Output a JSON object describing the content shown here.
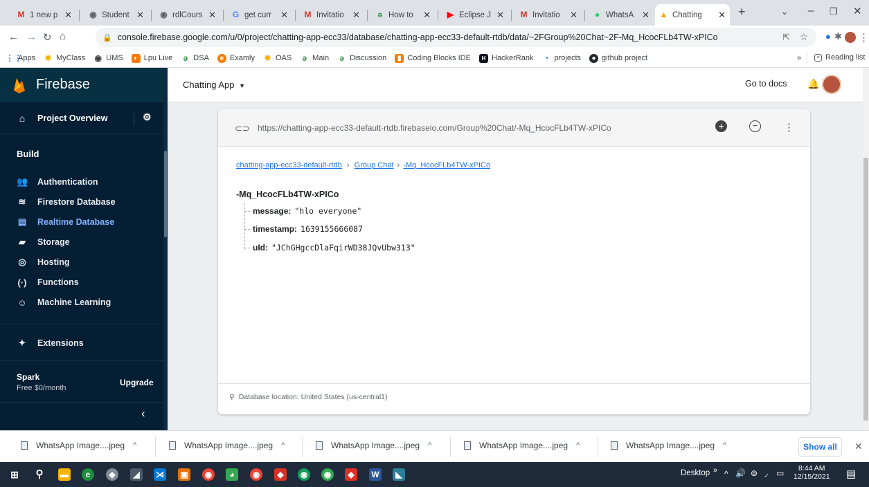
{
  "browser": {
    "tabs": [
      {
        "label": "1 new p",
        "icon": "gmail-icon"
      },
      {
        "label": "Student",
        "icon": "globe-icon"
      },
      {
        "label": "rdlCours",
        "icon": "globe-icon"
      },
      {
        "label": "get curr",
        "icon": "google-icon"
      },
      {
        "label": "Invitatio",
        "icon": "gmail-icon"
      },
      {
        "label": "How to",
        "icon": "gfg-icon"
      },
      {
        "label": "Eclipse J",
        "icon": "youtube-icon"
      },
      {
        "label": "Invitatio",
        "icon": "gmail-icon"
      },
      {
        "label": "WhatsA",
        "icon": "whatsapp-icon"
      },
      {
        "label": "Chatting",
        "icon": "firebase-icon",
        "active": true
      }
    ],
    "url": "console.firebase.google.com/u/0/project/chatting-app-ecc33/database/chatting-app-ecc33-default-rtdb/data/~2FGroup%20Chat~2F-Mq_HcocFLb4TW-xPICo",
    "bookmarks": [
      {
        "label": "Apps"
      },
      {
        "label": "MyClass"
      },
      {
        "label": "UMS"
      },
      {
        "label": "Lpu Live"
      },
      {
        "label": "DSA"
      },
      {
        "label": "Examly"
      },
      {
        "label": "OAS"
      },
      {
        "label": "Main"
      },
      {
        "label": "Discussion"
      },
      {
        "label": "Coding Blocks IDE"
      },
      {
        "label": "HackerRank"
      },
      {
        "label": "projects"
      },
      {
        "label": "github project"
      }
    ],
    "reading_list": "Reading list"
  },
  "firebase": {
    "logo_text": "Firebase",
    "project_name": "Chatting App",
    "go_to_docs": "Go to docs",
    "project_overview": "Project Overview",
    "build_label": "Build",
    "nav": [
      {
        "label": "Authentication",
        "icon": "users-icon"
      },
      {
        "label": "Firestore Database",
        "icon": "firestore-icon"
      },
      {
        "label": "Realtime Database",
        "icon": "database-icon",
        "active": true
      },
      {
        "label": "Storage",
        "icon": "storage-icon"
      },
      {
        "label": "Hosting",
        "icon": "hosting-icon"
      },
      {
        "label": "Functions",
        "icon": "functions-icon"
      },
      {
        "label": "Machine Learning",
        "icon": "robot-icon"
      }
    ],
    "extensions": "Extensions",
    "plan": {
      "name": "Spark",
      "price": "Free $0/month",
      "upgrade": "Upgrade"
    }
  },
  "database": {
    "ref_url": "https://chatting-app-ecc33-default-rtdb.firebaseio.com/Group%20Chat/-Mq_HcocFLb4TW-xPICo",
    "breadcrumb": [
      "chatting-app-ecc33-default-rtdb",
      "Group Chat",
      "-Mq_HcocFLb4TW-xPICo"
    ],
    "node_key": "-Mq_HcocFLb4TW-xPICo",
    "fields": [
      {
        "key": "message:",
        "value": "\"hlo everyone\""
      },
      {
        "key": "timestamp:",
        "value": "1639155666087"
      },
      {
        "key": "uId:",
        "value": "\"JChGHgccDlaFqirWD38JQvUbw313\""
      }
    ],
    "location": "Database location: United States (us-central1)"
  },
  "downloads": {
    "items": [
      "WhatsApp Image....jpeg",
      "WhatsApp Image....jpeg",
      "WhatsApp Image....jpeg",
      "WhatsApp Image....jpeg",
      "WhatsApp Image....jpeg"
    ],
    "show_all": "Show all"
  },
  "taskbar": {
    "desktop_label": "Desktop",
    "time": "8:44 AM",
    "date": "12/15/2021"
  }
}
